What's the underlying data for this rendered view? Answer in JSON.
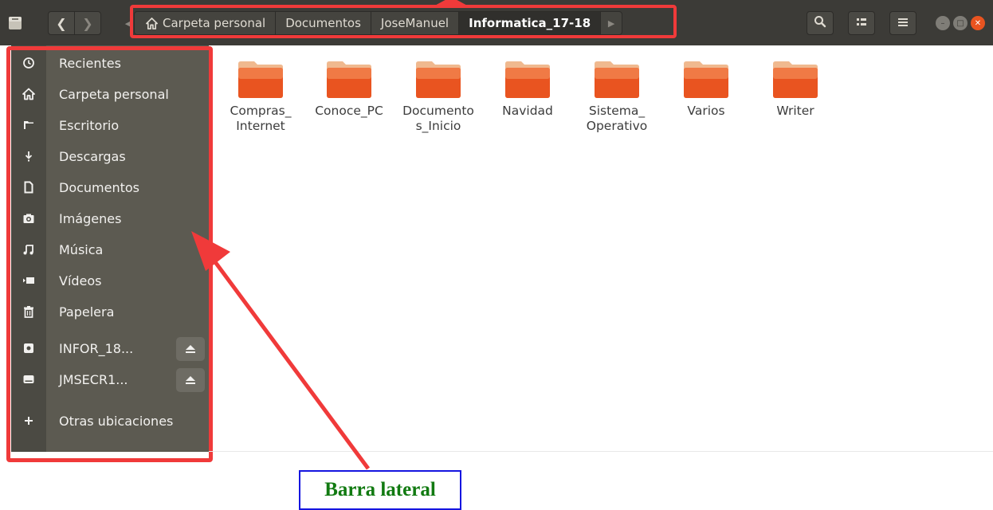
{
  "window": {
    "path": [
      {
        "label": "Carpeta personal",
        "icon": "home-icon"
      },
      {
        "label": "Documentos"
      },
      {
        "label": "JoseManuel"
      },
      {
        "label": "Informatica_17-18",
        "active": true
      }
    ],
    "toolbar": [
      "search-icon",
      "view-toggle-icon",
      "menu-icon"
    ],
    "window_controls": [
      "minimize",
      "maximize",
      "close"
    ]
  },
  "sidebar": {
    "items": [
      {
        "label": "Recientes",
        "icon": "clock-icon"
      },
      {
        "label": "Carpeta personal",
        "icon": "home-icon"
      },
      {
        "label": "Escritorio",
        "icon": "folder-icon"
      },
      {
        "label": "Descargas",
        "icon": "download-icon"
      },
      {
        "label": "Documentos",
        "icon": "document-icon"
      },
      {
        "label": "Imágenes",
        "icon": "camera-icon"
      },
      {
        "label": "Música",
        "icon": "music-icon"
      },
      {
        "label": "Vídeos",
        "icon": "video-icon"
      },
      {
        "label": "Papelera",
        "icon": "trash-icon"
      }
    ],
    "devices": [
      {
        "label": "INFOR_18...",
        "icon": "drive-icon",
        "eject": true
      },
      {
        "label": "JMSECR1...",
        "icon": "disk-icon",
        "eject": true
      }
    ],
    "other": {
      "label": "Otras ubicaciones",
      "icon": "plus-icon"
    }
  },
  "folders": [
    {
      "name": "Compras_\nInternet"
    },
    {
      "name": "Conoce_PC"
    },
    {
      "name": "Documento\ns_Inicio"
    },
    {
      "name": "Navidad"
    },
    {
      "name": "Sistema_\nOperativo"
    },
    {
      "name": "Varios"
    },
    {
      "name": "Writer"
    }
  ],
  "annotation": {
    "label": "Barra lateral"
  },
  "colors": {
    "header_bg": "#3c3b37",
    "sidebar_bg": "#5c5a51",
    "folder_orange": "#e95420",
    "highlight_red": "#f03a3a",
    "annotation_border": "#1515e0",
    "annotation_text": "#117a11"
  }
}
